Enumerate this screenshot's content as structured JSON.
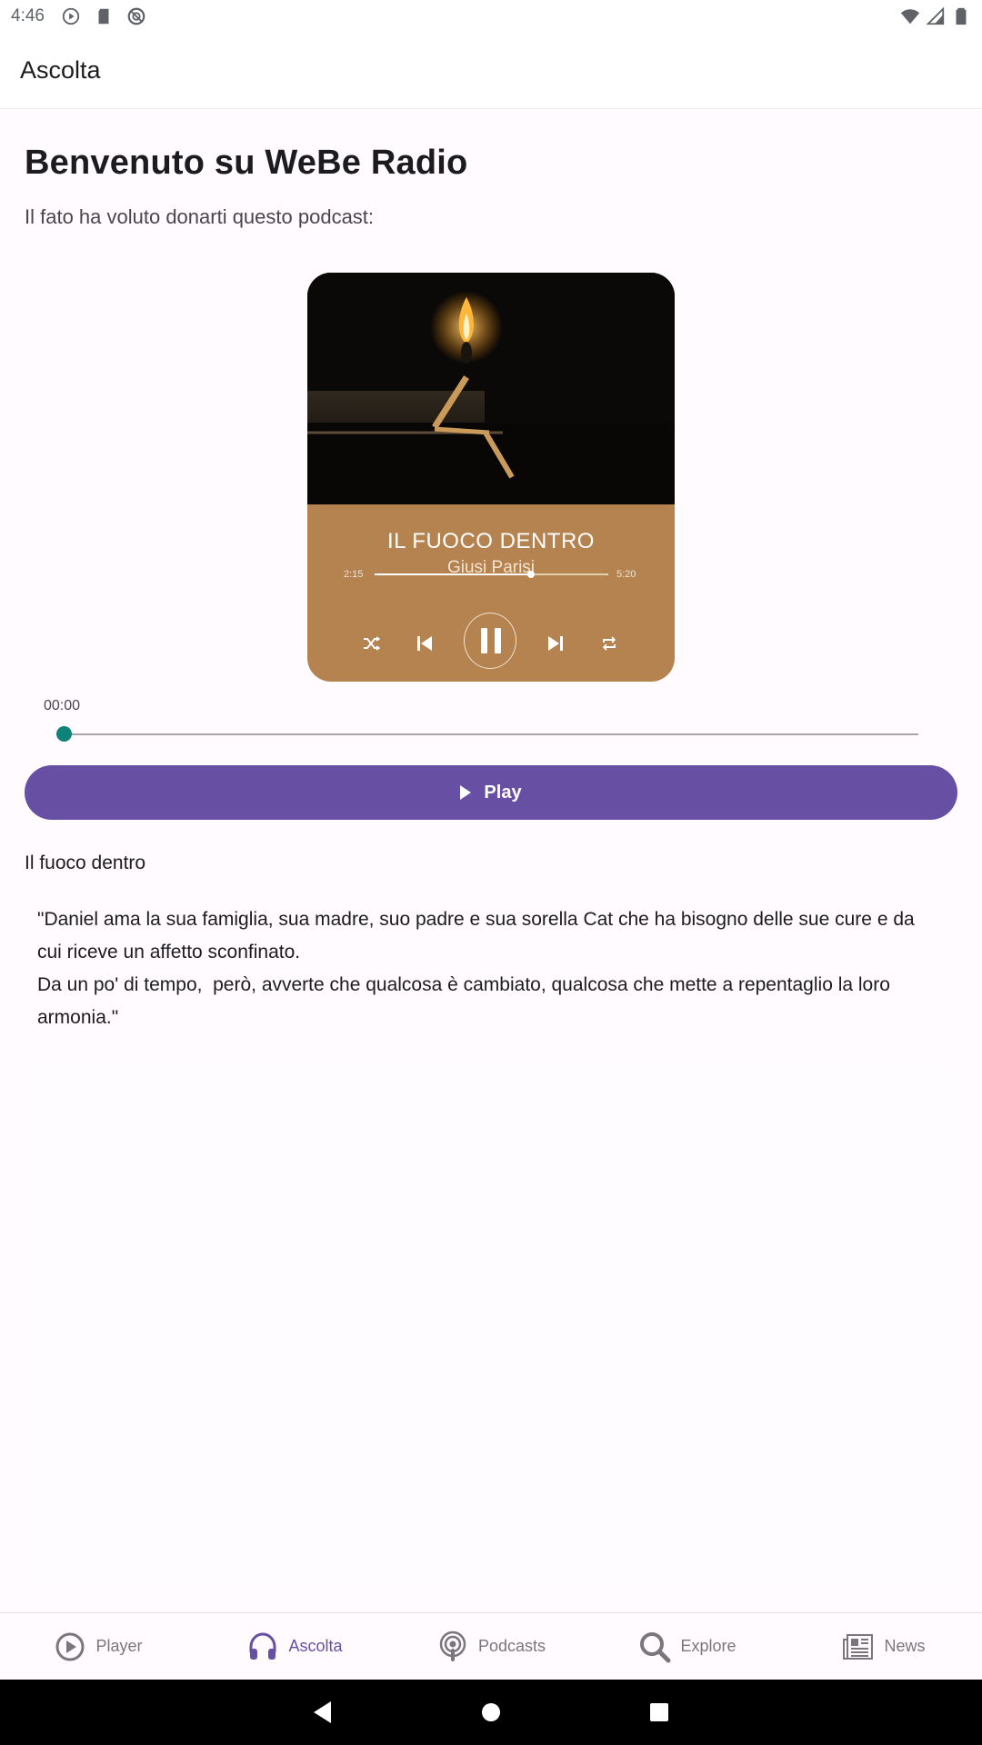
{
  "status_bar": {
    "time": "4:46",
    "icons_left": [
      "play-circle-icon",
      "sd-card-icon",
      "cast-icon"
    ],
    "icons_right": [
      "wifi-icon",
      "signal-icon",
      "battery-icon"
    ]
  },
  "app_bar": {
    "title": "Ascolta"
  },
  "main": {
    "welcome": "Benvenuto su WeBe Radio",
    "subtitle": "Il fato ha voluto donarti questo podcast:",
    "cover": {
      "title": "IL FUOCO DENTRO",
      "artist": "Giusi Parisi",
      "elapsed": "2:15",
      "duration": "5:20",
      "progress": 0.67,
      "controls": [
        "shuffle-icon",
        "skip-previous-icon",
        "pause-icon",
        "skip-next-icon",
        "repeat-icon"
      ]
    },
    "player": {
      "current_time": "00:00",
      "progress": 0.0,
      "play_label": "Play"
    },
    "episode": {
      "title": "Il fuoco dentro",
      "description": "\"Daniel ama la sua famiglia, sua madre, suo padre e sua sorella Cat che ha bisogno delle sue cure e da cui riceve un affetto sconfinato.\nDa un po' di tempo,  però, avverte che qualcosa è cambiato, qualcosa che mette a repentaglio la loro armonia.\""
    }
  },
  "bottom_nav": {
    "items": [
      {
        "label": "Player",
        "icon": "play-circle-icon",
        "active": false
      },
      {
        "label": "Ascolta",
        "icon": "headphones-icon",
        "active": true
      },
      {
        "label": "Podcasts",
        "icon": "podcast-icon",
        "active": false
      },
      {
        "label": "Explore",
        "icon": "search-icon",
        "active": false
      },
      {
        "label": "News",
        "icon": "newspaper-icon",
        "active": false
      }
    ]
  },
  "colors": {
    "accent": "#6750a4",
    "seek_knob": "#0f8378",
    "cover_panel": "#b4834f"
  }
}
